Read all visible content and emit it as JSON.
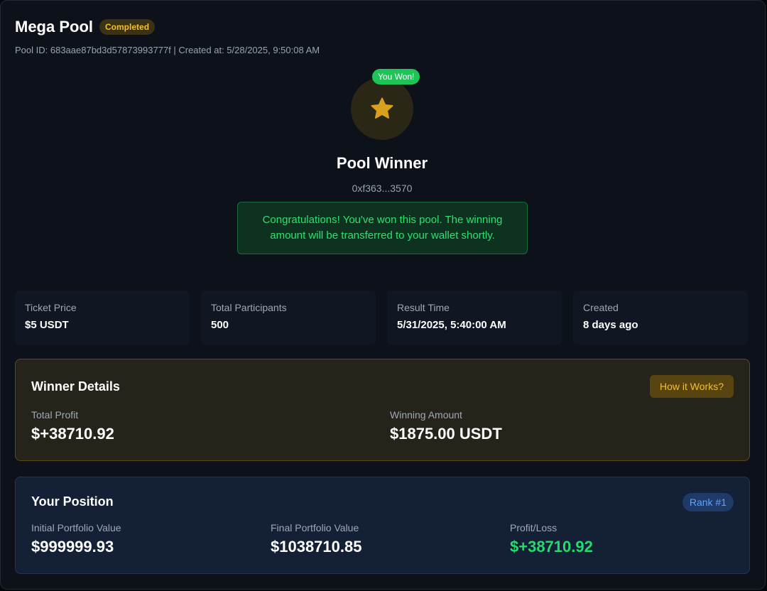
{
  "pool": {
    "title": "Mega Pool",
    "status": "Completed",
    "meta": "Pool ID: 683aae87bd3d57873993777f | Created at: 5/28/2025, 9:50:08 AM"
  },
  "winner": {
    "badge": "You Won!",
    "icon": "star-icon",
    "title": "Pool Winner",
    "address": "0xf363...3570",
    "message": "Congratulations! You've won this pool. The winning amount will be transferred to your wallet shortly."
  },
  "stats": [
    {
      "label": "Ticket Price",
      "value": "$5 USDT"
    },
    {
      "label": "Total Participants",
      "value": "500"
    },
    {
      "label": "Result Time",
      "value": "5/31/2025, 5:40:00 AM"
    },
    {
      "label": "Created",
      "value": "8 days ago"
    }
  ],
  "winner_details": {
    "title": "Winner Details",
    "button": "How it Works?",
    "total_profit_label": "Total Profit",
    "total_profit_value": "$+38710.92",
    "winning_amount_label": "Winning Amount",
    "winning_amount_value": "$1875.00 USDT"
  },
  "position": {
    "title": "Your Position",
    "rank": "Rank #1",
    "initial_label": "Initial Portfolio Value",
    "initial_value": "$999999.93",
    "final_label": "Final Portfolio Value",
    "final_value": "$1038710.85",
    "pl_label": "Profit/Loss",
    "pl_value": "$+38710.92"
  },
  "colors": {
    "accent_gold": "#f0c02e",
    "accent_green": "#22dd6a",
    "accent_blue": "#5ea2ff"
  }
}
